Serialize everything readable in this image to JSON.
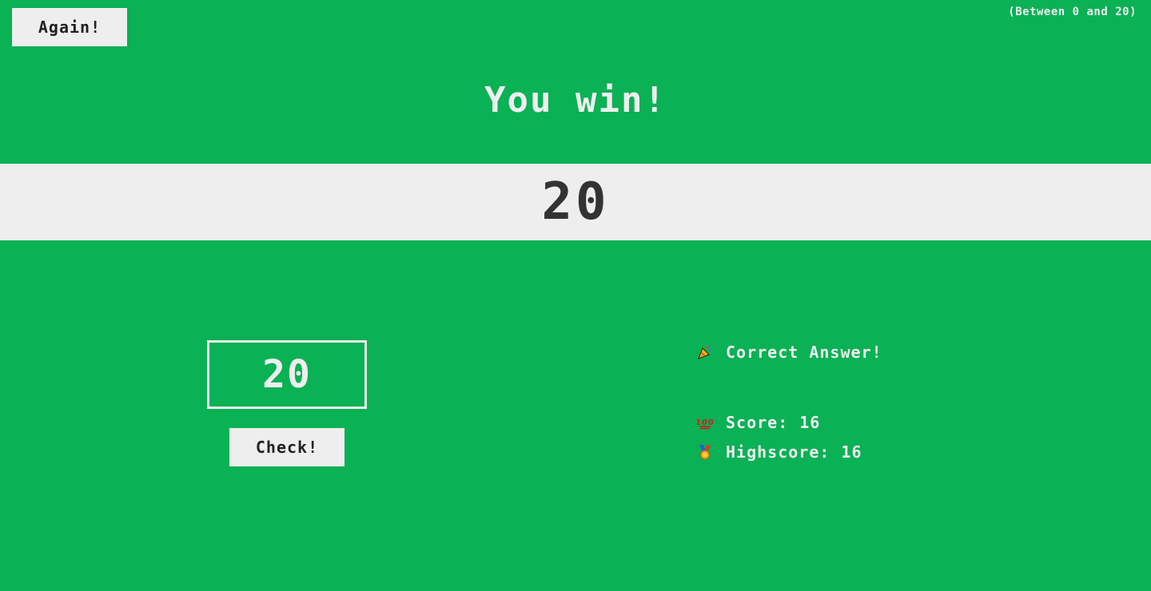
{
  "header": {
    "again_label": "Again!",
    "range_hint": "(Between 0 and 20)"
  },
  "title": "You win!",
  "secret_number": "20",
  "guess": {
    "value": "20"
  },
  "check_label": "Check!",
  "message": {
    "icon": "party-popper-icon",
    "text": "Correct Answer!"
  },
  "score": {
    "icon": "hundred-points-icon",
    "label": "Score:",
    "value": "16"
  },
  "highscore": {
    "icon": "medal-icon",
    "label": "Highscore:",
    "value": "16"
  },
  "colors": {
    "background": "#0bb155",
    "panel": "#eeeeee",
    "dark_text": "#333333"
  }
}
